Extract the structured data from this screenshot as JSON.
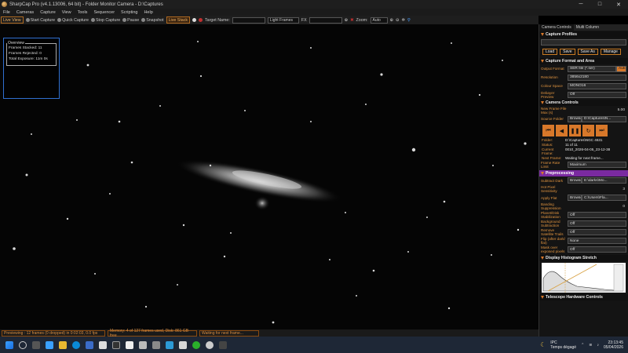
{
  "titlebar": {
    "title": "SharpCap Pro (v4.1.13006, 64 bit) - Folder Monitor Camera - D:\\Captures",
    "minimize": "─",
    "maximize": "□",
    "close": "✕"
  },
  "menu": [
    "File",
    "Cameras",
    "Capture",
    "View",
    "Tools",
    "Sequencer",
    "Scripting",
    "Help"
  ],
  "toolbar": {
    "live_view": "Live View",
    "start_capture": "Start Capture",
    "quick_capture": "Quick Capture",
    "stop_capture": "Stop Capture",
    "pause": "Pause",
    "snapshot": "Snapshot",
    "live_stack": "Live Stack",
    "target_name_label": "Target Name:",
    "target_name_value": "",
    "light_frames": "Light Frames",
    "fx_label": "FX",
    "zoom_label": "Zoom:",
    "zoom_value": "Auto"
  },
  "overview": {
    "heading": "Overview",
    "frames_stacked": "Frames Stacked: 11",
    "frames_rejected": "Frames Rejected: 0",
    "total_exposure": "Total Exposure: 11m 0s"
  },
  "status": {
    "previewing": "Previewing : 12 frames (0 dropped) in 0:02:03, 0.0 fps",
    "memory": "Memory: 4 of 127 frames used, Disk: 861 GB free",
    "waiting": "Waiting for next frame..."
  },
  "panel": {
    "tabs": [
      "Camera Controls",
      "Multi Column"
    ],
    "capture_profiles": {
      "title": "Capture Profiles",
      "buttons": [
        "Load",
        "Save",
        "Save As",
        "Manage"
      ]
    },
    "capture_format": {
      "title": "Capture Format and Area",
      "output_format_label": "Output Format",
      "output_format_value": "SER file (*.ser)",
      "auto": "Auto",
      "resolution_label": "Resolution",
      "resolution_value": "3856x2180",
      "colour_space_label": "Colour Space",
      "colour_space_value": "MONO16",
      "debayer_label": "Debayer Preview",
      "debayer_value": "Off"
    },
    "camera_controls": {
      "title": "Camera Controls",
      "new_frame_label": "New Frame File Max (s)",
      "new_frame_value": "5.00",
      "source_folder_label": "Source Folder",
      "source_folder_browse": "Browse...",
      "source_folder_value": "D:\\Captures\\N...",
      "folder_label": "Folder:",
      "folder_value": "D:\\Captures\\NGC 4631",
      "status_label": "Status:",
      "status_value": "11 of 11",
      "current_frame_label": "Current Frame:",
      "current_frame_value": "0010_2026-04-05_23-12-38",
      "next_frame_label": "Next Frame:",
      "next_frame_value": "Waiting for next frame...",
      "frame_rate_label": "Frame Rate Limit",
      "frame_rate_value": "Maximum"
    },
    "preprocessing": {
      "title": "Preprocessing",
      "subtract_dark_label": "Subtract Dark",
      "subtract_dark_browse": "Browse...",
      "subtract_dark_value": "E:\\darks\\Mo...",
      "hot_pixel_label": "Hot Pixel Sensitivity",
      "hot_pixel_value": "3",
      "apply_flat_label": "Apply Flat",
      "apply_flat_browse": "Browse...",
      "apply_flat_value": "C:\\Users\\Fla...",
      "banding_label": "Banding Suppression",
      "banding_value": "0",
      "planet_label": "Planet/Disk Stabilization",
      "planet_value": "Off",
      "background_label": "Background Subtraction",
      "background_value": "Off",
      "satellite_label": "Remove Satellite Trails",
      "satellite_value": "Off",
      "flip_label": "Flip (after dark/ flat)",
      "flip_value": "None",
      "mask_label": "Mask over exposed pixels",
      "mask_value": "Off"
    },
    "histogram": {
      "title": "Display Histogram Stretch"
    },
    "telescope": {
      "title": "Telescope Hardware Controls"
    }
  },
  "taskbar": {
    "weather": "IPC",
    "weather_sub": "Temps dégagé",
    "time": "23:13:45",
    "date": "05/04/2026"
  }
}
